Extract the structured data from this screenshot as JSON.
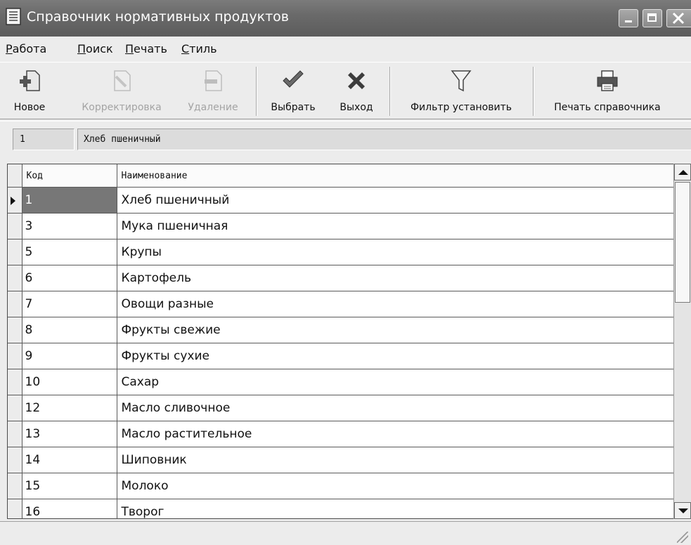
{
  "window": {
    "title": "Справочник нормативных продуктов"
  },
  "menu": [
    {
      "accel": "Р",
      "rest": "абота"
    },
    {
      "accel": "П",
      "rest": "оиск"
    },
    {
      "accel": "П",
      "rest": "ечать"
    },
    {
      "accel": "С",
      "rest": "тиль"
    }
  ],
  "toolbar": {
    "new": "Новое",
    "edit": "Корректировка",
    "delete": "Удаление",
    "select": "Выбрать",
    "exit": "Выход",
    "filter": "Фильтр установить",
    "print": "Печать справочника"
  },
  "current": {
    "code": "1",
    "name": "Хлеб пшеничный"
  },
  "grid": {
    "headers": {
      "code": "Код",
      "name": "Наименование"
    },
    "rows": [
      {
        "code": "1",
        "name": "Хлеб пшеничный"
      },
      {
        "code": "3",
        "name": "Мука пшеничная"
      },
      {
        "code": "5",
        "name": "Крупы"
      },
      {
        "code": "6",
        "name": "Картофель"
      },
      {
        "code": "7",
        "name": "Овощи разные"
      },
      {
        "code": "8",
        "name": "Фрукты свежие"
      },
      {
        "code": "9",
        "name": "Фрукты сухие"
      },
      {
        "code": "10",
        "name": "Сахар"
      },
      {
        "code": "12",
        "name": "Масло сливочное"
      },
      {
        "code": "13",
        "name": "Масло растительное"
      },
      {
        "code": "14",
        "name": "Шиповник"
      },
      {
        "code": "15",
        "name": "Молоко"
      },
      {
        "code": "16",
        "name": "Творог"
      }
    ]
  }
}
